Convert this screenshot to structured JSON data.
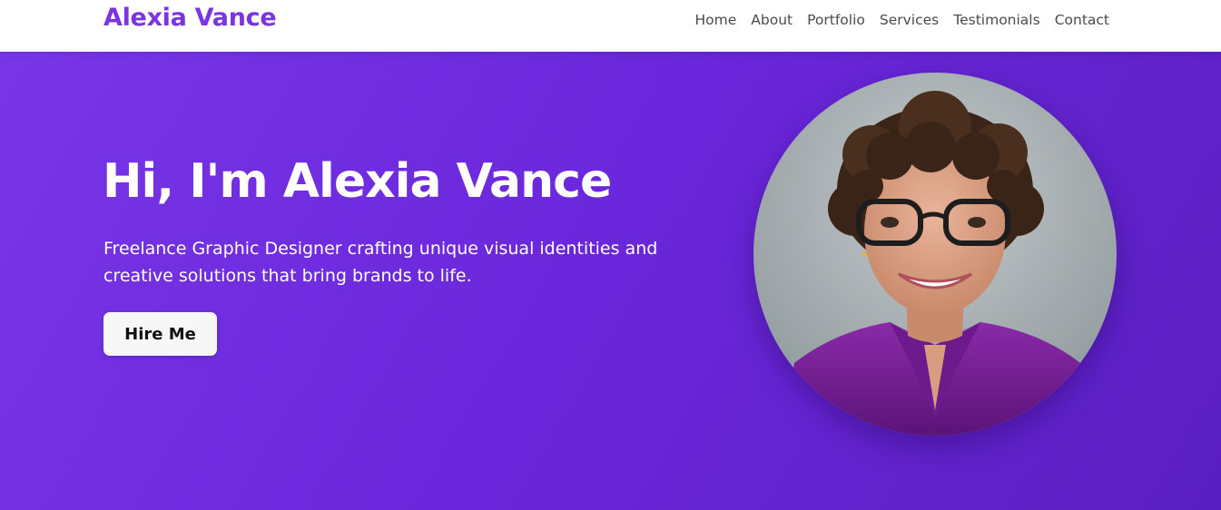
{
  "brand": {
    "name": "Alexia Vance",
    "color": "#7b35e0"
  },
  "nav": {
    "items": [
      {
        "label": "Home"
      },
      {
        "label": "About"
      },
      {
        "label": "Portfolio"
      },
      {
        "label": "Services"
      },
      {
        "label": "Testimonials"
      },
      {
        "label": "Contact"
      }
    ]
  },
  "hero": {
    "title": "Hi, I'm Alexia Vance",
    "subtitle": "Freelance Graphic Designer crafting unique visual identities and creative solutions that bring brands to life.",
    "cta_label": "Hire Me",
    "background_from": "#7836e8",
    "background_to": "#5a1fc0"
  },
  "portrait": {
    "icon": "profile-photo"
  }
}
